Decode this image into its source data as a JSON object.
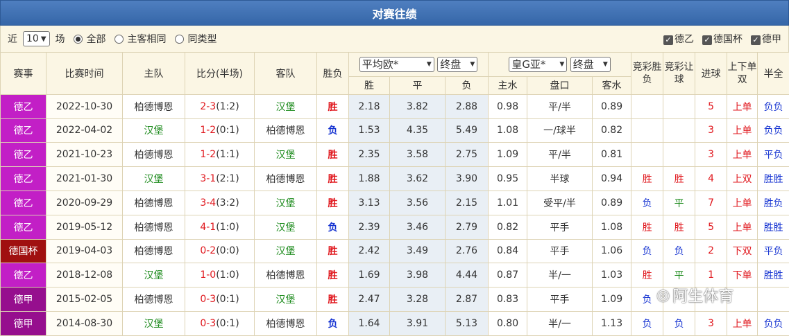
{
  "title": "对赛往绩",
  "filter": {
    "near_label": "近",
    "count_value": "10",
    "unit_label": "场",
    "radio_all": "全部",
    "radio_home_same": "主客相同",
    "radio_same_type": "同类型",
    "checks": [
      "德乙",
      "德国杯",
      "德甲"
    ]
  },
  "headers": {
    "league": "赛事",
    "time": "比赛时间",
    "home": "主队",
    "score": "比分(半场)",
    "away": "客队",
    "result": "胜负",
    "euro_select": "平均欧*",
    "euro_final": "终盘",
    "asia_select": "皇G亚*",
    "asia_final": "终盘",
    "lottery_wdl": "竞彩胜负",
    "lottery_handicap": "竞彩让球",
    "goals": "进球",
    "ou_oddeven": "上下单双",
    "half_full": "半全",
    "sub_win": "胜",
    "sub_draw": "平",
    "sub_lose": "负",
    "sub_home_water": "主水",
    "sub_handicap": "盘口",
    "sub_away_water": "客水"
  },
  "colors": {
    "league_2bl": "#c21fc6",
    "league_pokal": "#a01010",
    "league_bl": "#960f8e"
  },
  "rows": [
    {
      "league": "德乙",
      "lc": "#c21fc6",
      "date": "2022-10-30",
      "home": "柏德博恩",
      "hg": false,
      "score": "2-3",
      "half": "(1:2)",
      "away": "汉堡",
      "ag": true,
      "res": "胜",
      "rc": "red",
      "w": "2.18",
      "d": "3.82",
      "l": "2.88",
      "hw": "0.98",
      "hc": "平/半",
      "aw": "0.89",
      "lw": "",
      "lwc": "",
      "lh": "",
      "lhc": "",
      "goals": "5",
      "ou": "上单",
      "ouc": "red",
      "hf": "负负"
    },
    {
      "league": "德乙",
      "lc": "#c21fc6",
      "date": "2022-04-02",
      "home": "汉堡",
      "hg": true,
      "score": "1-2",
      "half": "(0:1)",
      "away": "柏德博恩",
      "ag": false,
      "res": "负",
      "rc": "blue",
      "w": "1.53",
      "d": "4.35",
      "l": "5.49",
      "hw": "1.08",
      "hc": "一/球半",
      "aw": "0.82",
      "lw": "",
      "lwc": "",
      "lh": "",
      "lhc": "",
      "goals": "3",
      "ou": "上单",
      "ouc": "red",
      "hf": "负负"
    },
    {
      "league": "德乙",
      "lc": "#c21fc6",
      "date": "2021-10-23",
      "home": "柏德博恩",
      "hg": false,
      "score": "1-2",
      "half": "(1:1)",
      "away": "汉堡",
      "ag": true,
      "res": "胜",
      "rc": "red",
      "w": "2.35",
      "d": "3.58",
      "l": "2.75",
      "hw": "1.09",
      "hc": "平/半",
      "aw": "0.81",
      "lw": "",
      "lwc": "",
      "lh": "",
      "lhc": "",
      "goals": "3",
      "ou": "上单",
      "ouc": "red",
      "hf": "平负"
    },
    {
      "league": "德乙",
      "lc": "#c21fc6",
      "date": "2021-01-30",
      "home": "汉堡",
      "hg": true,
      "score": "3-1",
      "half": "(2:1)",
      "away": "柏德博恩",
      "ag": false,
      "res": "胜",
      "rc": "red",
      "w": "1.88",
      "d": "3.62",
      "l": "3.90",
      "hw": "0.95",
      "hc": "半球",
      "aw": "0.94",
      "lw": "胜",
      "lwc": "red",
      "lh": "胜",
      "lhc": "red",
      "goals": "4",
      "ou": "上双",
      "ouc": "red",
      "hf": "胜胜"
    },
    {
      "league": "德乙",
      "lc": "#c21fc6",
      "date": "2020-09-29",
      "home": "柏德博恩",
      "hg": false,
      "score": "3-4",
      "half": "(3:2)",
      "away": "汉堡",
      "ag": true,
      "res": "胜",
      "rc": "red",
      "w": "3.13",
      "d": "3.56",
      "l": "2.15",
      "hw": "1.01",
      "hc": "受平/半",
      "aw": "0.89",
      "lw": "负",
      "lwc": "blue",
      "lh": "平",
      "lhc": "green",
      "goals": "7",
      "ou": "上单",
      "ouc": "red",
      "hf": "胜负"
    },
    {
      "league": "德乙",
      "lc": "#c21fc6",
      "date": "2019-05-12",
      "home": "柏德博恩",
      "hg": false,
      "score": "4-1",
      "half": "(1:0)",
      "away": "汉堡",
      "ag": true,
      "res": "负",
      "rc": "blue",
      "w": "2.39",
      "d": "3.46",
      "l": "2.79",
      "hw": "0.82",
      "hc": "平手",
      "aw": "1.08",
      "lw": "胜",
      "lwc": "red",
      "lh": "胜",
      "lhc": "red",
      "goals": "5",
      "ou": "上单",
      "ouc": "red",
      "hf": "胜胜"
    },
    {
      "league": "德国杯",
      "lc": "#a01010",
      "date": "2019-04-03",
      "home": "柏德博恩",
      "hg": false,
      "score": "0-2",
      "half": "(0:0)",
      "away": "汉堡",
      "ag": true,
      "res": "胜",
      "rc": "red",
      "w": "2.42",
      "d": "3.49",
      "l": "2.76",
      "hw": "0.84",
      "hc": "平手",
      "aw": "1.06",
      "lw": "负",
      "lwc": "blue",
      "lh": "负",
      "lhc": "blue",
      "goals": "2",
      "ou": "下双",
      "ouc": "red",
      "hf": "平负"
    },
    {
      "league": "德乙",
      "lc": "#c21fc6",
      "date": "2018-12-08",
      "home": "汉堡",
      "hg": true,
      "score": "1-0",
      "half": "(1:0)",
      "away": "柏德博恩",
      "ag": false,
      "res": "胜",
      "rc": "red",
      "w": "1.69",
      "d": "3.98",
      "l": "4.44",
      "hw": "0.87",
      "hc": "半/一",
      "aw": "1.03",
      "lw": "胜",
      "lwc": "red",
      "lh": "平",
      "lhc": "green",
      "goals": "1",
      "ou": "下单",
      "ouc": "red",
      "hf": "胜胜"
    },
    {
      "league": "德甲",
      "lc": "#960f8e",
      "date": "2015-02-05",
      "home": "柏德博恩",
      "hg": false,
      "score": "0-3",
      "half": "(0:1)",
      "away": "汉堡",
      "ag": true,
      "res": "胜",
      "rc": "red",
      "w": "2.47",
      "d": "3.28",
      "l": "2.87",
      "hw": "0.83",
      "hc": "平手",
      "aw": "1.09",
      "lw": "负",
      "lwc": "blue",
      "lh": "",
      "lhc": "",
      "goals": "",
      "ou": "",
      "ouc": "red",
      "hf": ""
    },
    {
      "league": "德甲",
      "lc": "#960f8e",
      "date": "2014-08-30",
      "home": "汉堡",
      "hg": true,
      "score": "0-3",
      "half": "(0:1)",
      "away": "柏德博恩",
      "ag": false,
      "res": "负",
      "rc": "blue",
      "w": "1.64",
      "d": "3.91",
      "l": "5.13",
      "hw": "0.80",
      "hc": "半/一",
      "aw": "1.13",
      "lw": "负",
      "lwc": "blue",
      "lh": "负",
      "lhc": "blue",
      "goals": "3",
      "ou": "上单",
      "ouc": "red",
      "hf": "负负"
    }
  ],
  "watermark": "阿生体育"
}
